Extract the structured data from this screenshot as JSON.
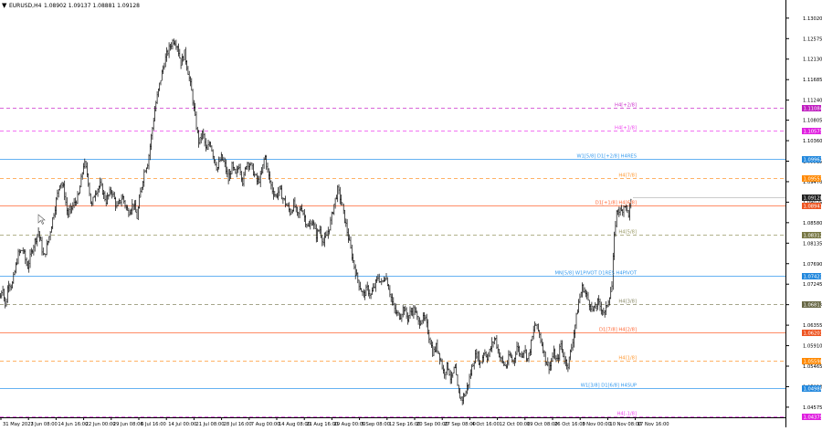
{
  "header": {
    "symbol_label": "EURUSD,H4",
    "ohlc": "1.08902 1.09137 1.08881 1.09128",
    "menu_icon": "triangle-down-icon"
  },
  "chart_data": {
    "type": "bar",
    "symbol": "EURUSD",
    "timeframe": "H4",
    "ylim": [
      1.04375,
      1.13235
    ],
    "y_ticks": [
      "1.13020",
      "1.12575",
      "1.12130",
      "1.11685",
      "1.11240",
      "1.10805",
      "1.10360",
      "1.09915",
      "1.09470",
      "1.09025",
      "1.08580",
      "1.08135",
      "1.07690",
      "1.07245",
      "1.06800",
      "1.06355",
      "1.05910",
      "1.05465",
      "1.05020",
      "1.04575"
    ],
    "x_ticks": [
      "31 May 2023",
      "7 Jun 08:00",
      "14 Jun 16:00",
      "22 Jun 00:00",
      "29 Jun 08:00",
      "6 Jul 16:00",
      "14 Jul 00:00",
      "21 Jul 08:00",
      "28 Jul 16:00",
      "7 Aug 00:00",
      "14 Aug 08:00",
      "21 Aug 16:00",
      "29 Aug 00:00",
      "5 Sep 08:00",
      "12 Sep 16:00",
      "20 Sep 00:00",
      "27 Sep 08:00",
      "4 Oct 16:00",
      "12 Oct 00:00",
      "19 Oct 08:00",
      "26 Oct 16:00",
      "3 Nov 00:00",
      "10 Nov 08:00",
      "17 Nov 16:00"
    ],
    "price_path": [
      [
        0,
        1.0695
      ],
      [
        3,
        1.072
      ],
      [
        6,
        1.067
      ],
      [
        9,
        1.073
      ],
      [
        13,
        1.072
      ],
      [
        20,
        1.079
      ],
      [
        25,
        1.08
      ],
      [
        30,
        1.076
      ],
      [
        36,
        1.0805
      ],
      [
        42,
        1.084
      ],
      [
        48,
        1.078
      ],
      [
        54,
        1.083
      ],
      [
        60,
        1.089
      ],
      [
        66,
        1.095
      ],
      [
        70,
        1.093
      ],
      [
        74,
        1.0875
      ],
      [
        80,
        1.0895
      ],
      [
        86,
        1.0915
      ],
      [
        92,
        1.099
      ],
      [
        96,
        1.096
      ],
      [
        100,
        1.089
      ],
      [
        104,
        1.0925
      ],
      [
        110,
        1.094
      ],
      [
        116,
        1.0905
      ],
      [
        122,
        1.093
      ],
      [
        128,
        1.089
      ],
      [
        134,
        1.0915
      ],
      [
        140,
        1.088
      ],
      [
        146,
        1.09
      ],
      [
        150,
        1.087
      ],
      [
        154,
        1.0925
      ],
      [
        158,
        1.097
      ],
      [
        162,
        1.099
      ],
      [
        166,
        1.105
      ],
      [
        170,
        1.111
      ],
      [
        174,
        1.115
      ],
      [
        178,
        1.119
      ],
      [
        182,
        1.122
      ],
      [
        186,
        1.124
      ],
      [
        190,
        1.1255
      ],
      [
        194,
        1.1245
      ],
      [
        198,
        1.1205
      ],
      [
        202,
        1.1225
      ],
      [
        206,
        1.1185
      ],
      [
        210,
        1.114
      ],
      [
        214,
        1.108
      ],
      [
        218,
        1.103
      ],
      [
        222,
        1.1055
      ],
      [
        226,
        1.101
      ],
      [
        230,
        1.1035
      ],
      [
        234,
        1.1
      ],
      [
        238,
        1.0975
      ],
      [
        242,
        1.1
      ],
      [
        246,
        1.0985
      ],
      [
        250,
        1.095
      ],
      [
        254,
        1.098
      ],
      [
        258,
        1.096
      ],
      [
        262,
        1.0985
      ],
      [
        266,
        1.0945
      ],
      [
        270,
        1.099
      ],
      [
        274,
        1.0985
      ],
      [
        278,
        1.0965
      ],
      [
        282,
        1.0945
      ],
      [
        286,
        1.096
      ],
      [
        290,
        1.1005
      ],
      [
        294,
        1.096
      ],
      [
        298,
        1.093
      ],
      [
        302,
        1.0915
      ],
      [
        306,
        1.093
      ],
      [
        310,
        1.091
      ],
      [
        314,
        1.0895
      ],
      [
        318,
        1.088
      ],
      [
        322,
        1.09
      ],
      [
        326,
        1.087
      ],
      [
        330,
        1.0895
      ],
      [
        334,
        1.0865
      ],
      [
        338,
        1.0845
      ],
      [
        342,
        1.0865
      ],
      [
        346,
        1.083
      ],
      [
        350,
        1.0845
      ],
      [
        354,
        1.0815
      ],
      [
        358,
        1.083
      ],
      [
        362,
        1.086
      ],
      [
        366,
        1.09
      ],
      [
        370,
        1.093
      ],
      [
        374,
        1.09
      ],
      [
        378,
        1.086
      ],
      [
        382,
        1.082
      ],
      [
        386,
        1.078
      ],
      [
        390,
        1.0745
      ],
      [
        394,
        1.072
      ],
      [
        398,
        1.07
      ],
      [
        402,
        1.0715
      ],
      [
        406,
        1.07
      ],
      [
        410,
        1.072
      ],
      [
        414,
        1.074
      ],
      [
        418,
        1.0725
      ],
      [
        422,
        1.0745
      ],
      [
        426,
        1.0715
      ],
      [
        430,
        1.068
      ],
      [
        434,
        1.066
      ],
      [
        438,
        1.0655
      ],
      [
        442,
        1.0675
      ],
      [
        446,
        1.065
      ],
      [
        450,
        1.0665
      ],
      [
        454,
        1.067
      ],
      [
        458,
        1.064
      ],
      [
        462,
        1.065
      ],
      [
        466,
        1.0645
      ],
      [
        470,
        1.061
      ],
      [
        474,
        1.0575
      ],
      [
        478,
        1.059
      ],
      [
        482,
        1.0565
      ],
      [
        486,
        1.053
      ],
      [
        490,
        1.055
      ],
      [
        494,
        1.0515
      ],
      [
        498,
        1.0545
      ],
      [
        502,
        1.0485
      ],
      [
        506,
        1.0475
      ],
      [
        510,
        1.049
      ],
      [
        514,
        1.052
      ],
      [
        518,
        1.0555
      ],
      [
        522,
        1.0575
      ],
      [
        526,
        1.055
      ],
      [
        530,
        1.058
      ],
      [
        534,
        1.0565
      ],
      [
        538,
        1.059
      ],
      [
        542,
        1.061
      ],
      [
        546,
        1.0575
      ],
      [
        550,
        1.0555
      ],
      [
        554,
        1.0545
      ],
      [
        558,
        1.057
      ],
      [
        562,
        1.0555
      ],
      [
        566,
        1.059
      ],
      [
        570,
        1.057
      ],
      [
        574,
        1.0585
      ],
      [
        578,
        1.056
      ],
      [
        582,
        1.06
      ],
      [
        586,
        1.064
      ],
      [
        590,
        1.062
      ],
      [
        594,
        1.059
      ],
      [
        598,
        1.0555
      ],
      [
        602,
        1.0545
      ],
      [
        606,
        1.0575
      ],
      [
        610,
        1.0555
      ],
      [
        614,
        1.0595
      ],
      [
        618,
        1.056
      ],
      [
        622,
        1.055
      ],
      [
        626,
        1.059
      ],
      [
        630,
        1.064
      ],
      [
        634,
        1.069
      ],
      [
        638,
        1.072
      ],
      [
        642,
        1.07
      ],
      [
        646,
        1.068
      ],
      [
        650,
        1.0665
      ],
      [
        654,
        1.0685
      ],
      [
        658,
        1.0675
      ],
      [
        662,
        1.066
      ],
      [
        666,
        1.069
      ],
      [
        670,
        1.072
      ],
      [
        672,
        1.081
      ],
      [
        674,
        1.086
      ],
      [
        676,
        1.089
      ],
      [
        680,
        1.088
      ],
      [
        684,
        1.09
      ],
      [
        688,
        1.0875
      ],
      [
        692,
        1.0913
      ]
    ],
    "levels": [
      {
        "label": "H4[+2/8]",
        "price": "1.11084",
        "value": 1.11084,
        "color": "#cc33cc",
        "style": "dashed",
        "badge_bg": "#c020c0"
      },
      {
        "label": "H4[+1/8]",
        "price": "1.10575",
        "value": 1.10575,
        "color": "#ee44ee",
        "style": "dashed",
        "badge_bg": "#e020e0"
      },
      {
        "label": "W1[5/8] D1[+2/8] H4RES",
        "price": "1.09962",
        "value": 1.09962,
        "color": "#3399ee",
        "style": "solid",
        "badge_bg": "#2288dd"
      },
      {
        "label": "H4[7/8]",
        "price": "1.09553",
        "value": 1.09553,
        "color": "#ff9933",
        "style": "dashed",
        "badge_bg": "#ff8800"
      },
      {
        "label": "D1[+1/8] H4[6/8]",
        "price": "1.08947",
        "value": 1.08947,
        "color": "#ff6633",
        "style": "solid",
        "badge_bg": "#ee5522"
      },
      {
        "label": "H4[5/8]",
        "price": "1.08312",
        "value": 1.08312,
        "color": "#999966",
        "style": "dashed",
        "badge_bg": "#777744"
      },
      {
        "label": "MN[5/8] W1PIVOT D1RES H4PIVOT",
        "price": "1.07423",
        "value": 1.07423,
        "color": "#3399ee",
        "style": "solid",
        "badge_bg": "#2288dd"
      },
      {
        "label": "H4[3/8]",
        "price": "1.06812",
        "value": 1.06812,
        "color": "#888866",
        "style": "dashed",
        "badge_bg": "#666644"
      },
      {
        "label": "D1[7/8] H4[2/8]",
        "price": "1.06201",
        "value": 1.06201,
        "color": "#ff6633",
        "style": "solid",
        "badge_bg": "#ee5522"
      },
      {
        "label": "H4[1/8]",
        "price": "1.05590",
        "value": 1.0559,
        "color": "#ff9933",
        "style": "dashed",
        "badge_bg": "#ff8800"
      },
      {
        "label": "W1[3/8] D1[6/8] H4SUP",
        "price": "1.04980",
        "value": 1.0498,
        "color": "#3399ee",
        "style": "solid",
        "badge_bg": "#2288dd"
      },
      {
        "label": "H4[-1/8]",
        "price": "1.04375",
        "value": 1.04375,
        "color": "#ee44ee",
        "style": "dashed",
        "badge_bg": "#e020e0"
      }
    ],
    "current_price": {
      "price": "1.09128",
      "value": 1.09128,
      "badge_bg": "#222222"
    }
  }
}
